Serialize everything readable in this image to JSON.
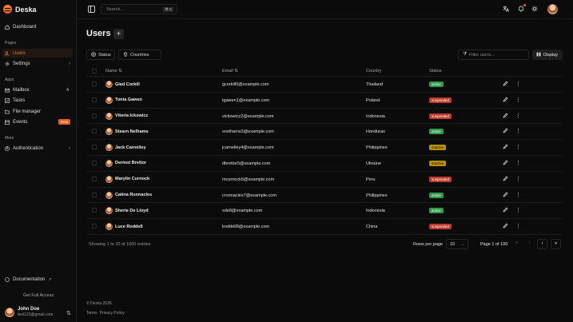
{
  "brand": {
    "name": "Deska"
  },
  "sidebar": {
    "sections": {
      "pages": "Pages",
      "apps": "Apps",
      "more": "More"
    },
    "dashboard": "Dashboard",
    "users": "Users",
    "settings": "Settings",
    "mailbox": "Mailbox",
    "mailbox_count": "4",
    "tasks": "Tasks",
    "file_manager": "File manager",
    "events": "Events",
    "events_badge": "New",
    "authentication": "Authentication",
    "documentation": "Documentation",
    "get_full_access": "Get Full Access",
    "user": {
      "name": "John Doe",
      "email": "test123@gmail.com"
    }
  },
  "topbar": {
    "search_placeholder": "Search...",
    "search_shortcut": "⌘ K"
  },
  "page": {
    "title": "Users",
    "add_label": "+"
  },
  "filters": {
    "status": "Status",
    "countries": "Countries",
    "filter_placeholder": "Filter users...",
    "display": "Display"
  },
  "table": {
    "columns": {
      "name": "Name",
      "email": "Email",
      "country": "Country",
      "status": "Status"
    },
    "rows": [
      {
        "name": "Glad Corkill",
        "email": "gcorkill0@example.com",
        "country": "Thailand",
        "status": "active"
      },
      {
        "name": "Tonia Gawen",
        "email": "tgawen1@example.com",
        "country": "Poland",
        "status": "suspended"
      },
      {
        "name": "Vitoria Ickowicz",
        "email": "vickowicz2@example.com",
        "country": "Indonesia",
        "status": "suspended"
      },
      {
        "name": "Stearn Nelhams",
        "email": "snelhams3@example.com",
        "country": "Honduras",
        "status": "active"
      },
      {
        "name": "Jack Carnelley",
        "email": "jcarnelley4@example.com",
        "country": "Philippines",
        "status": "inactive"
      },
      {
        "name": "Dermot Brettor",
        "email": "dbrettor5@example.com",
        "country": "Ukraine",
        "status": "inactive"
      },
      {
        "name": "Marylin Curnock",
        "email": "mcurnock6@example.com",
        "country": "Peru",
        "status": "suspended"
      },
      {
        "name": "Catina Runnacles",
        "email": "crunnacles7@example.com",
        "country": "Philippines",
        "status": "active"
      },
      {
        "name": "Sherie De Lloyd",
        "email": "sde8@example.com",
        "country": "Indonesia",
        "status": "active"
      },
      {
        "name": "Luce Roddell",
        "email": "lroddell9@example.com",
        "country": "China",
        "status": "suspended"
      }
    ]
  },
  "pagination": {
    "showing": "Showing 1 to 10 of 1000 entries",
    "rows_per_page_label": "Rows per page",
    "rows_per_page": "10",
    "page_info": "Page 1 of 100"
  },
  "footer": {
    "copyright": "© Deska 2026",
    "terms": "Terms",
    "privacy": "Privacy Policy"
  },
  "colors": {
    "accent": "#f07a33",
    "active": "#2e9a4a",
    "suspended": "#c0392b",
    "inactive": "#b8900f"
  }
}
